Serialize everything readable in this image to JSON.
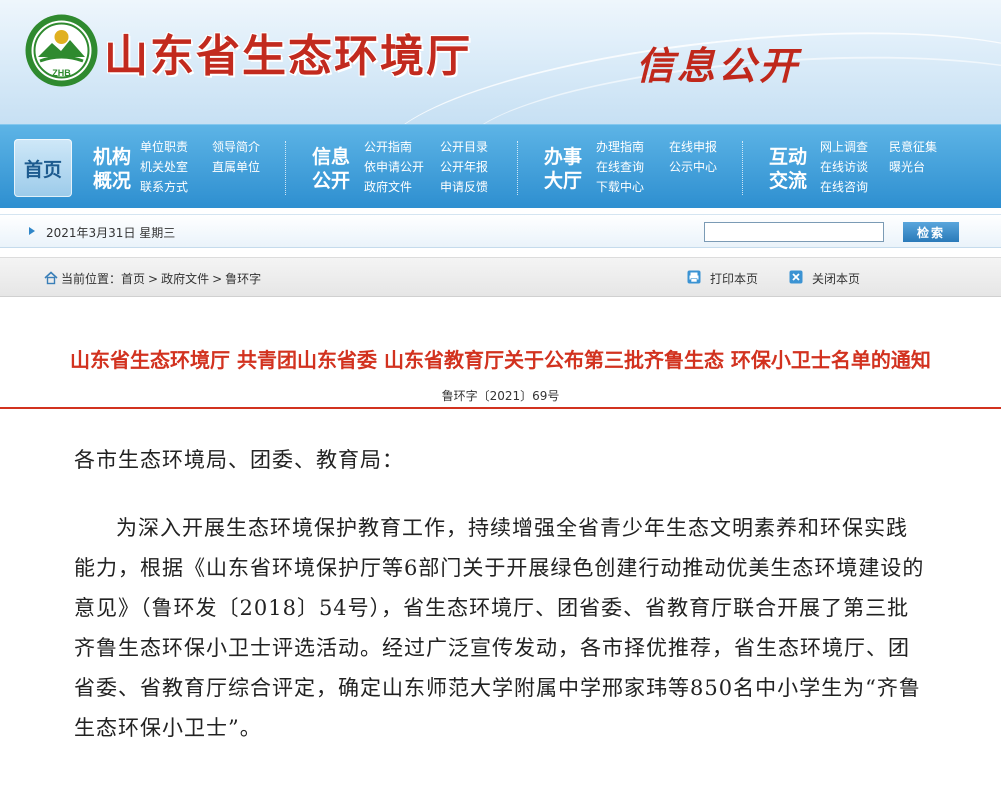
{
  "header": {
    "logo_text": "ZHB",
    "site_title": "山东省生态环境厅",
    "slogan": "信息公开"
  },
  "nav": {
    "home": "首页",
    "groups": [
      {
        "title_line1": "机构",
        "title_line2": "概况",
        "links": [
          "单位职责",
          "领导简介",
          "机关处室",
          "直属单位",
          "联系方式"
        ]
      },
      {
        "title_line1": "信息",
        "title_line2": "公开",
        "links": [
          "公开指南",
          "公开目录",
          "依申请公开",
          "公开年报",
          "政府文件",
          "申请反馈"
        ]
      },
      {
        "title_line1": "办事",
        "title_line2": "大厅",
        "links": [
          "办理指南",
          "在线申报",
          "在线查询",
          "公示中心",
          "下载中心"
        ]
      },
      {
        "title_line1": "互动",
        "title_line2": "交流",
        "links": [
          "网上调查",
          "民意征集",
          "在线访谈",
          "曝光台",
          "在线咨询"
        ]
      }
    ]
  },
  "date_bar": {
    "date": "2021年3月31日 星期三",
    "search_value": "",
    "search_button": "检索"
  },
  "breadcrumb": {
    "prefix": "当前位置：",
    "items": [
      "首页",
      "政府文件",
      "鲁环字"
    ],
    "separator": ">"
  },
  "tools": {
    "print": "打印本页",
    "close": "关闭本页"
  },
  "article": {
    "title": "山东省生态环境厅 共青团山东省委 山东省教育厅关于公布第三批齐鲁生态 环保小卫士名单的通知",
    "doc_number": "鲁环字〔2021〕69号",
    "salutation": "各市生态环境局、团委、教育局：",
    "paragraph": "为深入开展生态环境保护教育工作，持续增强全省青少年生态文明素养和环保实践能力，根据《山东省环境保护厅等6部门关于开展绿色创建行动推动优美生态环境建设的意见》（鲁环发〔2018〕54号），省生态环境厅、团省委、省教育厅联合开展了第三批齐鲁生态环保小卫士评选活动。经过广泛宣传发动，各市择优推荐，省生态环境厅、团省委、省教育厅综合评定，确定山东师范大学附属中学邢家玮等850名中小学生为“齐鲁生态环保小卫士”。"
  },
  "colors": {
    "title_red": "#d2321f",
    "nav_blue": "#2e8fd0",
    "logo_green": "#2f8a2f"
  }
}
